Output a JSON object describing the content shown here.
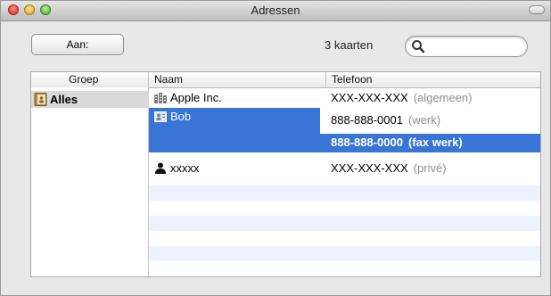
{
  "window": {
    "title": "Adressen"
  },
  "toolbar": {
    "aan_label": "Aan:",
    "card_count": "3 kaarten",
    "search_value": ""
  },
  "columns": {
    "group": "Groep",
    "name": "Naam",
    "phone": "Telefoon"
  },
  "groups": [
    {
      "label": "Alles",
      "icon": "address-book-icon",
      "selected": true
    }
  ],
  "contacts": [
    {
      "name": "Apple Inc.",
      "icon": "company-icon",
      "phones": [
        {
          "number": "XXX-XXX-XXX",
          "label": "(algemeen)"
        }
      ]
    },
    {
      "name": "Bob",
      "icon": "contact-card-icon",
      "selected": true,
      "phones": [
        {
          "number": "888-888-0001",
          "label": "(werk)"
        },
        {
          "number": "888-888-0000",
          "label": "(fax werk)",
          "highlighted": true
        }
      ]
    },
    {
      "name": "xxxxx",
      "icon": "person-icon",
      "phones": [
        {
          "number": "XXX-XXX-XXX",
          "label": "(privé)"
        }
      ]
    }
  ],
  "colors": {
    "selection": "#3875d7",
    "stripe": "#edf3fe",
    "group_selected": "#d9d9d9"
  }
}
